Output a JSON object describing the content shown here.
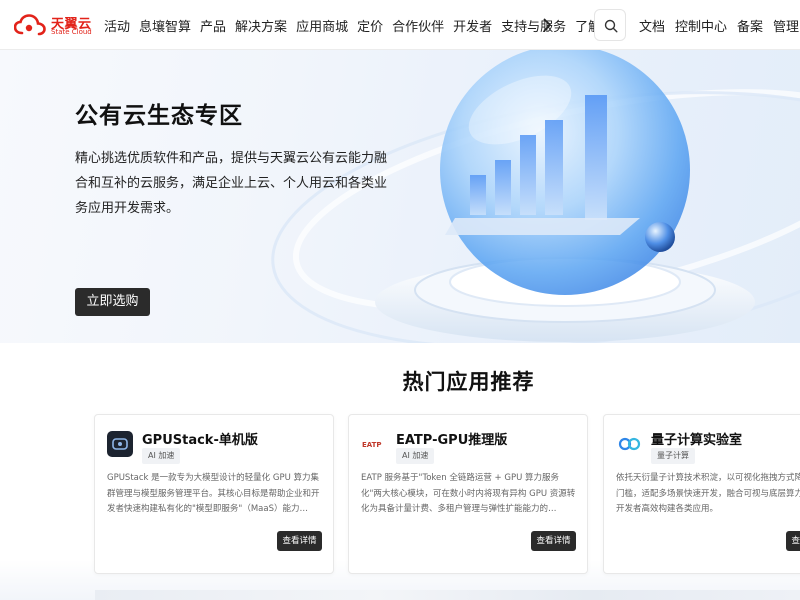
{
  "brand": {
    "name_cn": "天翼云",
    "name_en": "State Cloud",
    "color": "#e2231a"
  },
  "nav": {
    "items": [
      "活动",
      "息壤智算",
      "产品",
      "解决方案",
      "应用商城",
      "定价",
      "合作伙伴",
      "开发者",
      "支持与服务",
      "了解"
    ],
    "more_icon": "chevron-right-icon",
    "search_icon": "search-icon",
    "right": [
      "文档",
      "控制中心",
      "备案",
      "管理中心"
    ]
  },
  "hero": {
    "title": "公有云生态专区",
    "description": "精心挑选优质软件和产品，提供与天翼云公有云能力融合和互补的云服务，满足企业上云、个人用云和各类业务应用开发需求。",
    "button": "立即选购"
  },
  "section": {
    "title": "热门应用推荐",
    "cards": [
      {
        "title": "GPUStack-单机版",
        "tag": "AI 加速",
        "icon": "gpustack-icon",
        "description": "GPUStack 是一款专为大模型设计的轻量化 GPU 算力集群管理与模型服务管理平台。其核心目标是帮助企业和开发者快速构建私有化的\"模型即服务\"（MaaS）能力…",
        "button": "查看详情"
      },
      {
        "title": "EATP-GPU推理版",
        "tag": "AI 加速",
        "icon": "eatp-icon",
        "icon_text": "EATP",
        "description": "EATP 服务基于\"Token 全链路运营 + GPU 算力服务化\"两大核心模块，可在数小时内将现有异构 GPU 资源转化为具备计量计费、多租户管理与弹性扩能能力的…",
        "button": "查看详情"
      },
      {
        "title": "量子计算实验室",
        "tag": "量子计算",
        "icon": "quantum-icon",
        "description": "依托天衍量子计算技术积淀，以可视化拖拽方式降低编码门槛，适配多场景快速开发，融合可视与底层算力，赋能开发者高效构建各类应用。",
        "button": "查看详情"
      }
    ]
  },
  "colors": {
    "accent": "#e2231a",
    "button_dark": "#2b2b2b",
    "hero_blue": "#3d7ff0"
  }
}
